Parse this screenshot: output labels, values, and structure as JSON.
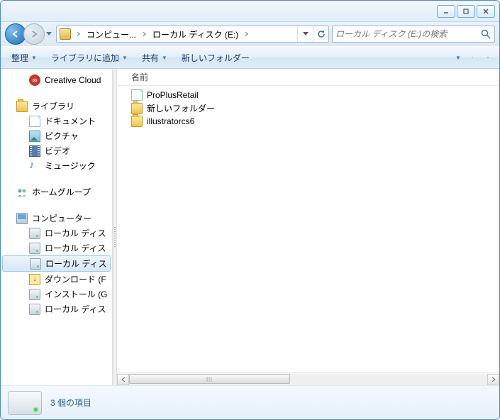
{
  "window_controls": {
    "min": "minimize",
    "max": "maximize",
    "close": "close"
  },
  "breadcrumb": {
    "segments": [
      "コンピュー...",
      "ローカル ディスク (E:)"
    ]
  },
  "search": {
    "placeholder": "ローカル ディスク (E:)の検索"
  },
  "toolbar": {
    "organize": "整理",
    "add_library": "ライブラリに追加",
    "share": "共有",
    "new_folder": "新しいフォルダー"
  },
  "sidebar": {
    "creative_cloud": "Creative Cloud",
    "libraries": "ライブラリ",
    "documents": "ドキュメント",
    "pictures": "ピクチャ",
    "videos": "ビデオ",
    "music": "ミュージック",
    "homegroup": "ホームグループ",
    "computer": "コンピューター",
    "local_disk_a": "ローカル ディス",
    "local_disk_b": "ローカル ディス",
    "local_disk_sel": "ローカル ディス",
    "downloads": "ダウンロード (F",
    "install": "インストール (G",
    "local_disk_c": "ローカル ディス"
  },
  "columns": {
    "name": "名前"
  },
  "files": [
    {
      "icon": "doc",
      "name": "ProPlusRetail"
    },
    {
      "icon": "folder",
      "name": "新しいフォルダー"
    },
    {
      "icon": "folder",
      "name": "illustratorcs6"
    }
  ],
  "status": {
    "text": "3 個の項目"
  }
}
